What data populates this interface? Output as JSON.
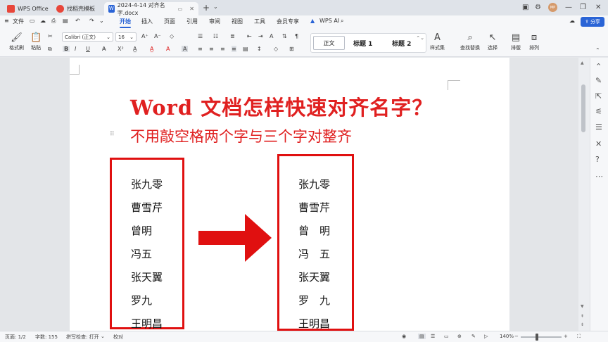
{
  "tabs": [
    {
      "label": "WPS Office",
      "icon": "wps-logo-icon",
      "color": "#e8463a"
    },
    {
      "label": "找稻壳模板",
      "icon": "template-icon",
      "color": "#e8463a"
    },
    {
      "label": "2024-4-14 对齐名字.docx",
      "icon": "word-doc-icon",
      "color": "#2a64d6"
    }
  ],
  "avatar_text": "MP",
  "menu": {
    "file_label": "文件",
    "items": [
      "开始",
      "插入",
      "页面",
      "引用",
      "审阅",
      "视图",
      "工具",
      "会员专享"
    ],
    "active": "开始",
    "ai_label": "WPS AI",
    "share_label": "分享"
  },
  "ribbon": {
    "format_painter": "格式刷",
    "paste": "粘贴",
    "font_name": "Calibri (正文)",
    "font_size": "16",
    "styles": [
      "正文",
      "标题 1",
      "标题 2"
    ],
    "style_set": "样式集",
    "find_replace": "查找替换",
    "select": "选择",
    "layout": "排版",
    "arrange": "排列",
    "bold": "B",
    "italic": "I",
    "underline": "U"
  },
  "document": {
    "title": "Word 文档怎样快速对齐名字？",
    "subtitle": "不用敲空格两个字与三个字对整齐",
    "names_before": [
      "张九零",
      "曹雪芹",
      "曾明",
      "冯五",
      "张天翼",
      "罗九",
      "王明昌"
    ],
    "names_after": [
      "张九零",
      "曹雪芹",
      "曾　明",
      "冯　五",
      "张天翼",
      "罗　九",
      "王明昌"
    ],
    "accent_color": "#e02020"
  },
  "status": {
    "page": "页面: 1/2",
    "word_count": "字数: 155",
    "spellcheck": "拼写检查: 打开",
    "proofread": "校对",
    "zoom": "140%"
  }
}
